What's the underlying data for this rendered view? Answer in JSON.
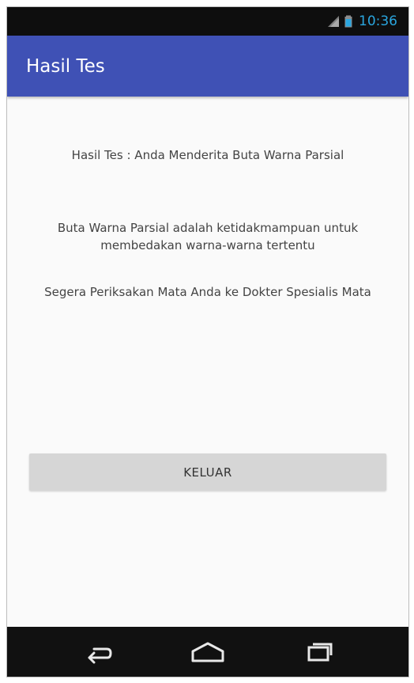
{
  "status_bar": {
    "time": "10:36",
    "icons": [
      "signal-icon",
      "battery-icon"
    ],
    "colors": {
      "background": "#0e0e0e",
      "clock": "#2aa6df"
    }
  },
  "app_bar": {
    "title": "Hasil Tes",
    "color": "#3f51b5"
  },
  "content": {
    "result_text": "Hasil Tes : Anda Menderita Buta Warna Parsial",
    "description_text": "Buta Warna Parsial adalah ketidakmampuan untuk membedakan warna-warna tertentu",
    "advice_text": "Segera Periksakan Mata Anda ke Dokter Spesialis Mata",
    "exit_button_label": "KELUAR"
  },
  "navigation_bar": {
    "icons": [
      "back-icon",
      "home-icon",
      "recent-apps-icon"
    ],
    "color": "#111111"
  }
}
